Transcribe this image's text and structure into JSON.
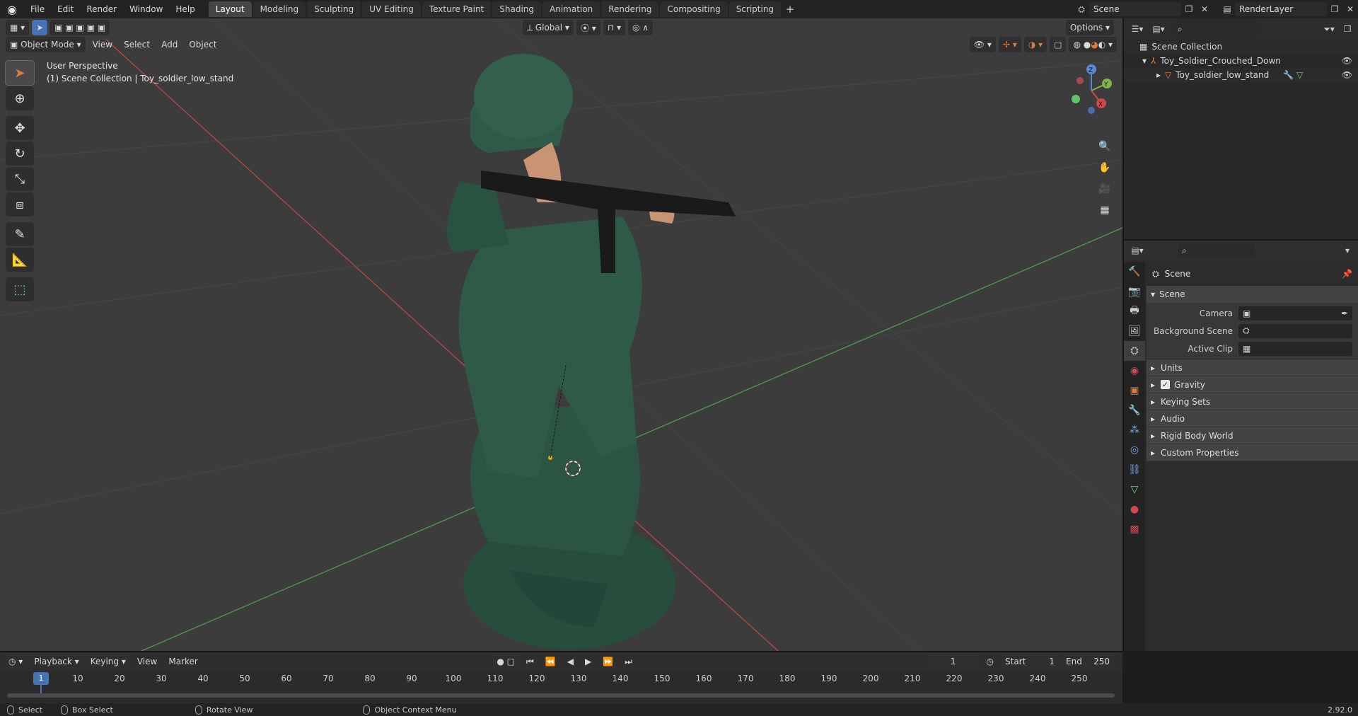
{
  "topbar": {
    "menus": [
      "File",
      "Edit",
      "Render",
      "Window",
      "Help"
    ],
    "workspaces": [
      {
        "label": "Layout",
        "active": true
      },
      {
        "label": "Modeling"
      },
      {
        "label": "Sculpting"
      },
      {
        "label": "UV Editing"
      },
      {
        "label": "Texture Paint"
      },
      {
        "label": "Shading"
      },
      {
        "label": "Animation"
      },
      {
        "label": "Rendering"
      },
      {
        "label": "Compositing"
      },
      {
        "label": "Scripting"
      }
    ],
    "add_label": "+",
    "scene_name": "Scene",
    "render_layer": "RenderLayer"
  },
  "viewport": {
    "mode": "Object Mode",
    "menus": [
      "View",
      "Select",
      "Add",
      "Object"
    ],
    "transform_orientation": "Global",
    "options_label": "Options",
    "perspective": "User Perspective",
    "collection_line": "(1) Scene Collection | Toy_soldier_low_stand",
    "gizmo_axes": {
      "x": "X",
      "y": "Y",
      "z": "Z"
    },
    "colors": {
      "bg": "#3c3c3c",
      "grid": "#464646",
      "axis_x": "#c74c4c",
      "axis_y": "#5ea55e",
      "soldier": "#2f5a48"
    }
  },
  "outliner": {
    "root": "Scene Collection",
    "items": [
      {
        "label": "Toy_Soldier_Crouched_Down",
        "indent": 1
      },
      {
        "label": "Toy_soldier_low_stand",
        "indent": 2
      }
    ]
  },
  "properties": {
    "context": "Scene",
    "panel_title": "Scene",
    "fields": [
      {
        "label": "Camera",
        "value": ""
      },
      {
        "label": "Background Scene",
        "value": ""
      },
      {
        "label": "Active Clip",
        "value": ""
      }
    ],
    "subpanels": [
      {
        "label": "Units"
      },
      {
        "label": "Gravity",
        "checkbox": true
      },
      {
        "label": "Keying Sets"
      },
      {
        "label": "Audio"
      },
      {
        "label": "Rigid Body World"
      },
      {
        "label": "Custom Properties"
      }
    ]
  },
  "timeline": {
    "menus": [
      "Playback",
      "Keying",
      "View",
      "Marker"
    ],
    "current_frame": "1",
    "start_label": "Start",
    "start_value": "1",
    "end_label": "End",
    "end_value": "250",
    "ticks": [
      "10",
      "20",
      "30",
      "40",
      "50",
      "60",
      "70",
      "80",
      "90",
      "100",
      "110",
      "120",
      "130",
      "140",
      "150",
      "160",
      "170",
      "180",
      "190",
      "200",
      "210",
      "220",
      "230",
      "240",
      "250"
    ],
    "playhead_label": "1"
  },
  "statusbar": {
    "select": "Select",
    "box_select": "Box Select",
    "rotate_view": "Rotate View",
    "context_menu": "Object Context Menu",
    "version": "2.92.0"
  }
}
